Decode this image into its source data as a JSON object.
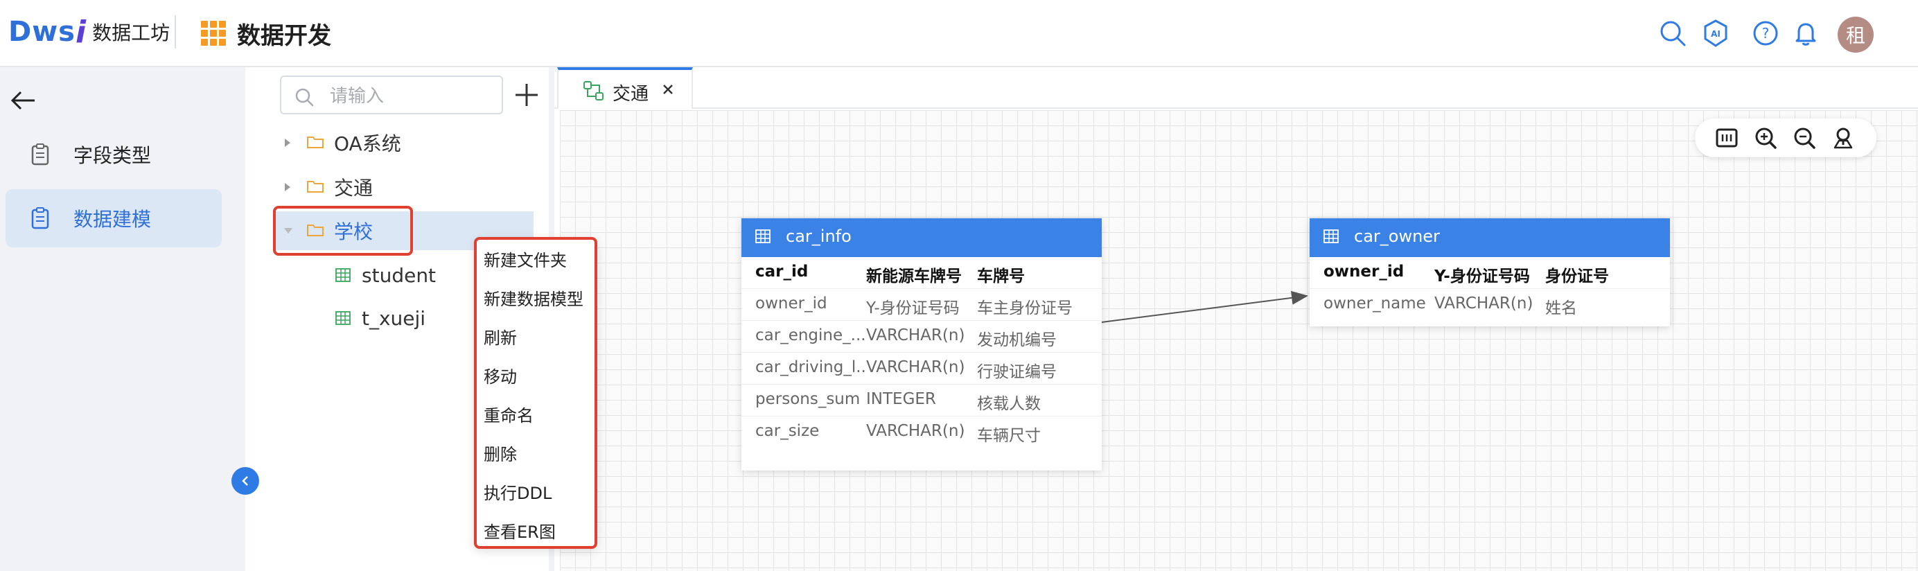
{
  "header": {
    "logo_text": "Dws",
    "logo_i": "i",
    "logo_sub": "数据工坊",
    "module_title": "数据开发",
    "avatar_text": "租",
    "icons": [
      "search-icon",
      "ai-icon",
      "help-icon",
      "bell-icon"
    ]
  },
  "leftnav": {
    "items": [
      {
        "label": "字段类型",
        "icon": "clipboard-icon",
        "active": false
      },
      {
        "label": "数据建模",
        "icon": "clipboard-icon",
        "active": true
      }
    ]
  },
  "tree": {
    "search_placeholder": "请输入",
    "folders": [
      {
        "label": "OA系统",
        "expanded": false
      },
      {
        "label": "交通",
        "expanded": false
      },
      {
        "label": "学校",
        "expanded": true
      }
    ],
    "children": [
      {
        "label": "student"
      },
      {
        "label": "t_xueji"
      }
    ]
  },
  "context_menu": {
    "items": [
      "新建文件夹",
      "新建数据模型",
      "刷新",
      "移动",
      "重命名",
      "删除",
      "执行DDL",
      "查看ER图"
    ]
  },
  "canvas": {
    "tab_label": "交通",
    "tables": [
      {
        "name": "car_info",
        "columns": [
          [
            "car_id",
            "新能源车牌号",
            "车牌号"
          ],
          [
            "owner_id",
            "Y-身份证号码",
            "车主身份证号"
          ],
          [
            "car_engine_...",
            "VARCHAR(n)",
            "发动机编号"
          ],
          [
            "car_driving_l...",
            "VARCHAR(n)",
            "行驶证编号"
          ],
          [
            "persons_sum",
            "INTEGER",
            "核载人数"
          ],
          [
            "car_size",
            "VARCHAR(n)",
            "车辆尺寸"
          ]
        ]
      },
      {
        "name": "car_owner",
        "columns": [
          [
            "owner_id",
            "Y-身份证号码",
            "身份证号"
          ],
          [
            "owner_name",
            "VARCHAR(n)",
            "姓名"
          ]
        ]
      }
    ]
  },
  "colors": {
    "accent": "#2f7be5",
    "highlight_border": "#e0402f",
    "folder": "#f0a53a",
    "table_header": "#3b82e6"
  }
}
